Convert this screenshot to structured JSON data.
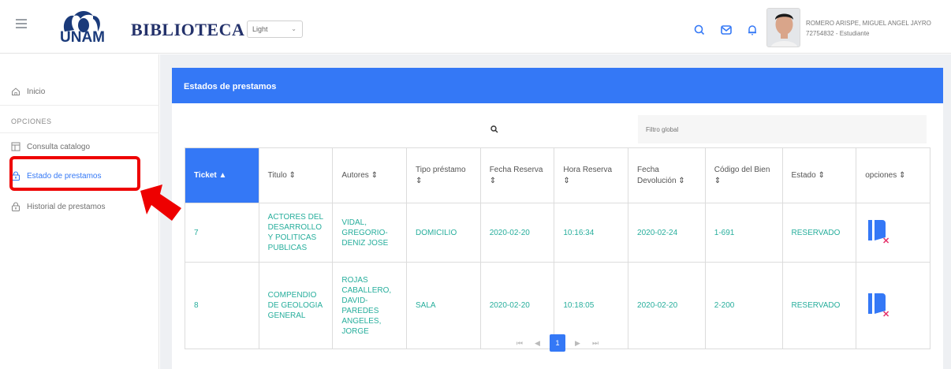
{
  "header": {
    "brand": "BIBLIOTECA",
    "logo_text": "UNAM",
    "theme_select_value": "Light",
    "user_name": "ROMERO ARISPE, MIGUEL ANGEL JAYRO",
    "user_id": "72754832 - Estudiante"
  },
  "sidebar": {
    "home_label": "Inicio",
    "section_label": "OPCIONES",
    "items": [
      {
        "label": "Consulta catalogo"
      },
      {
        "label": "Estado de prestamos"
      },
      {
        "label": "Historial de prestamos"
      }
    ]
  },
  "panel": {
    "title": "Estados de prestamos",
    "filter_placeholder": "Filtro global"
  },
  "table": {
    "headers": [
      "Ticket",
      "Titulo",
      "Autores",
      "Tipo préstamo",
      "Fecha Reserva",
      "Hora Reserva",
      "Fecha Devolución",
      "Código del Bien",
      "Estado",
      "opciones"
    ],
    "rows": [
      {
        "ticket": "7",
        "titulo": "ACTORES DEL DESARROLLO Y POLITICAS PUBLICAS",
        "autores": "VIDAL, GREGORIO-DENIZ JOSE",
        "tipo": "DOMICILIO",
        "fecha_reserva": "2020-02-20",
        "hora_reserva": "10:16:34",
        "fecha_devolucion": "2020-02-24",
        "codigo": "1-691",
        "estado": "RESERVADO"
      },
      {
        "ticket": "8",
        "titulo": "COMPENDIO DE GEOLOGIA GENERAL",
        "autores": "ROJAS CABALLERO, DAVID-PAREDES ANGELES, JORGE",
        "tipo": "SALA",
        "fecha_reserva": "2020-02-20",
        "hora_reserva": "10:18:05",
        "fecha_devolucion": "2020-02-20",
        "codigo": "2-200",
        "estado": "RESERVADO"
      }
    ]
  },
  "pager": {
    "first": "⏮",
    "prev": "◀",
    "current": "1",
    "next": "▶",
    "last": "⏭"
  },
  "colors": {
    "accent": "#3478f6",
    "link_text": "#27ae9c",
    "highlight": "#ee0000",
    "brand": "#24326b"
  }
}
